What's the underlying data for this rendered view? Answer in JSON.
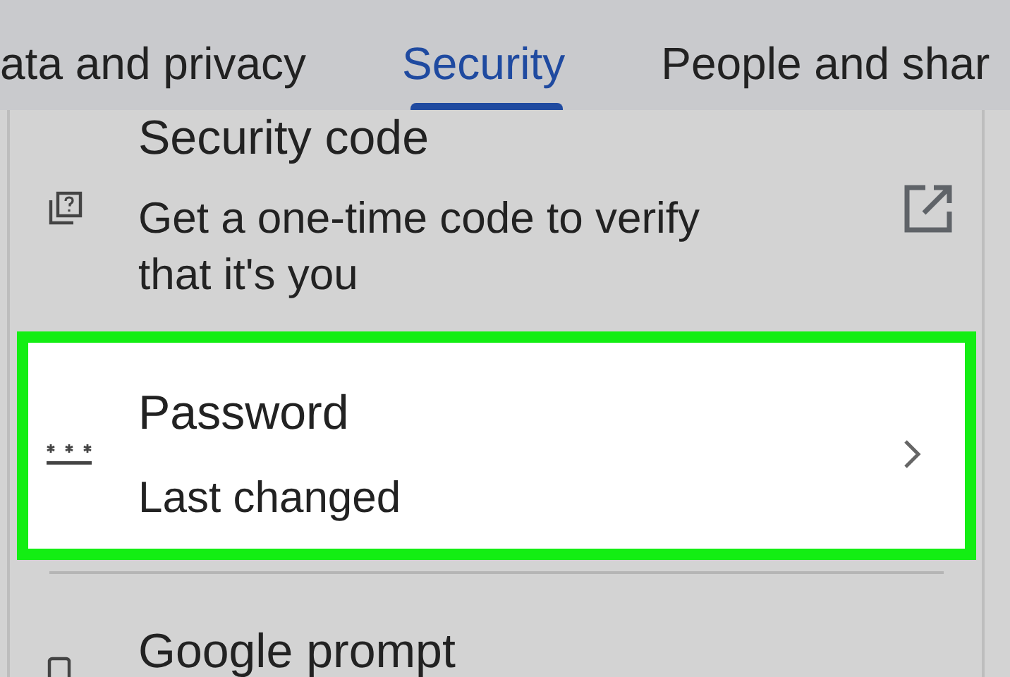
{
  "tabs": [
    {
      "label": "ata and privacy",
      "selected": false
    },
    {
      "label": "Security",
      "selected": true
    },
    {
      "label": "People and shar",
      "selected": false
    }
  ],
  "items": [
    {
      "kind": "external",
      "title": "Security code",
      "subtitle": "Get a one-time code to verify that it's you",
      "highlighted": false
    },
    {
      "kind": "chevron",
      "title": "Password",
      "subtitle": "Last changed",
      "highlighted": true
    },
    {
      "kind": "none",
      "title": "Google prompt",
      "highlighted": false
    }
  ]
}
